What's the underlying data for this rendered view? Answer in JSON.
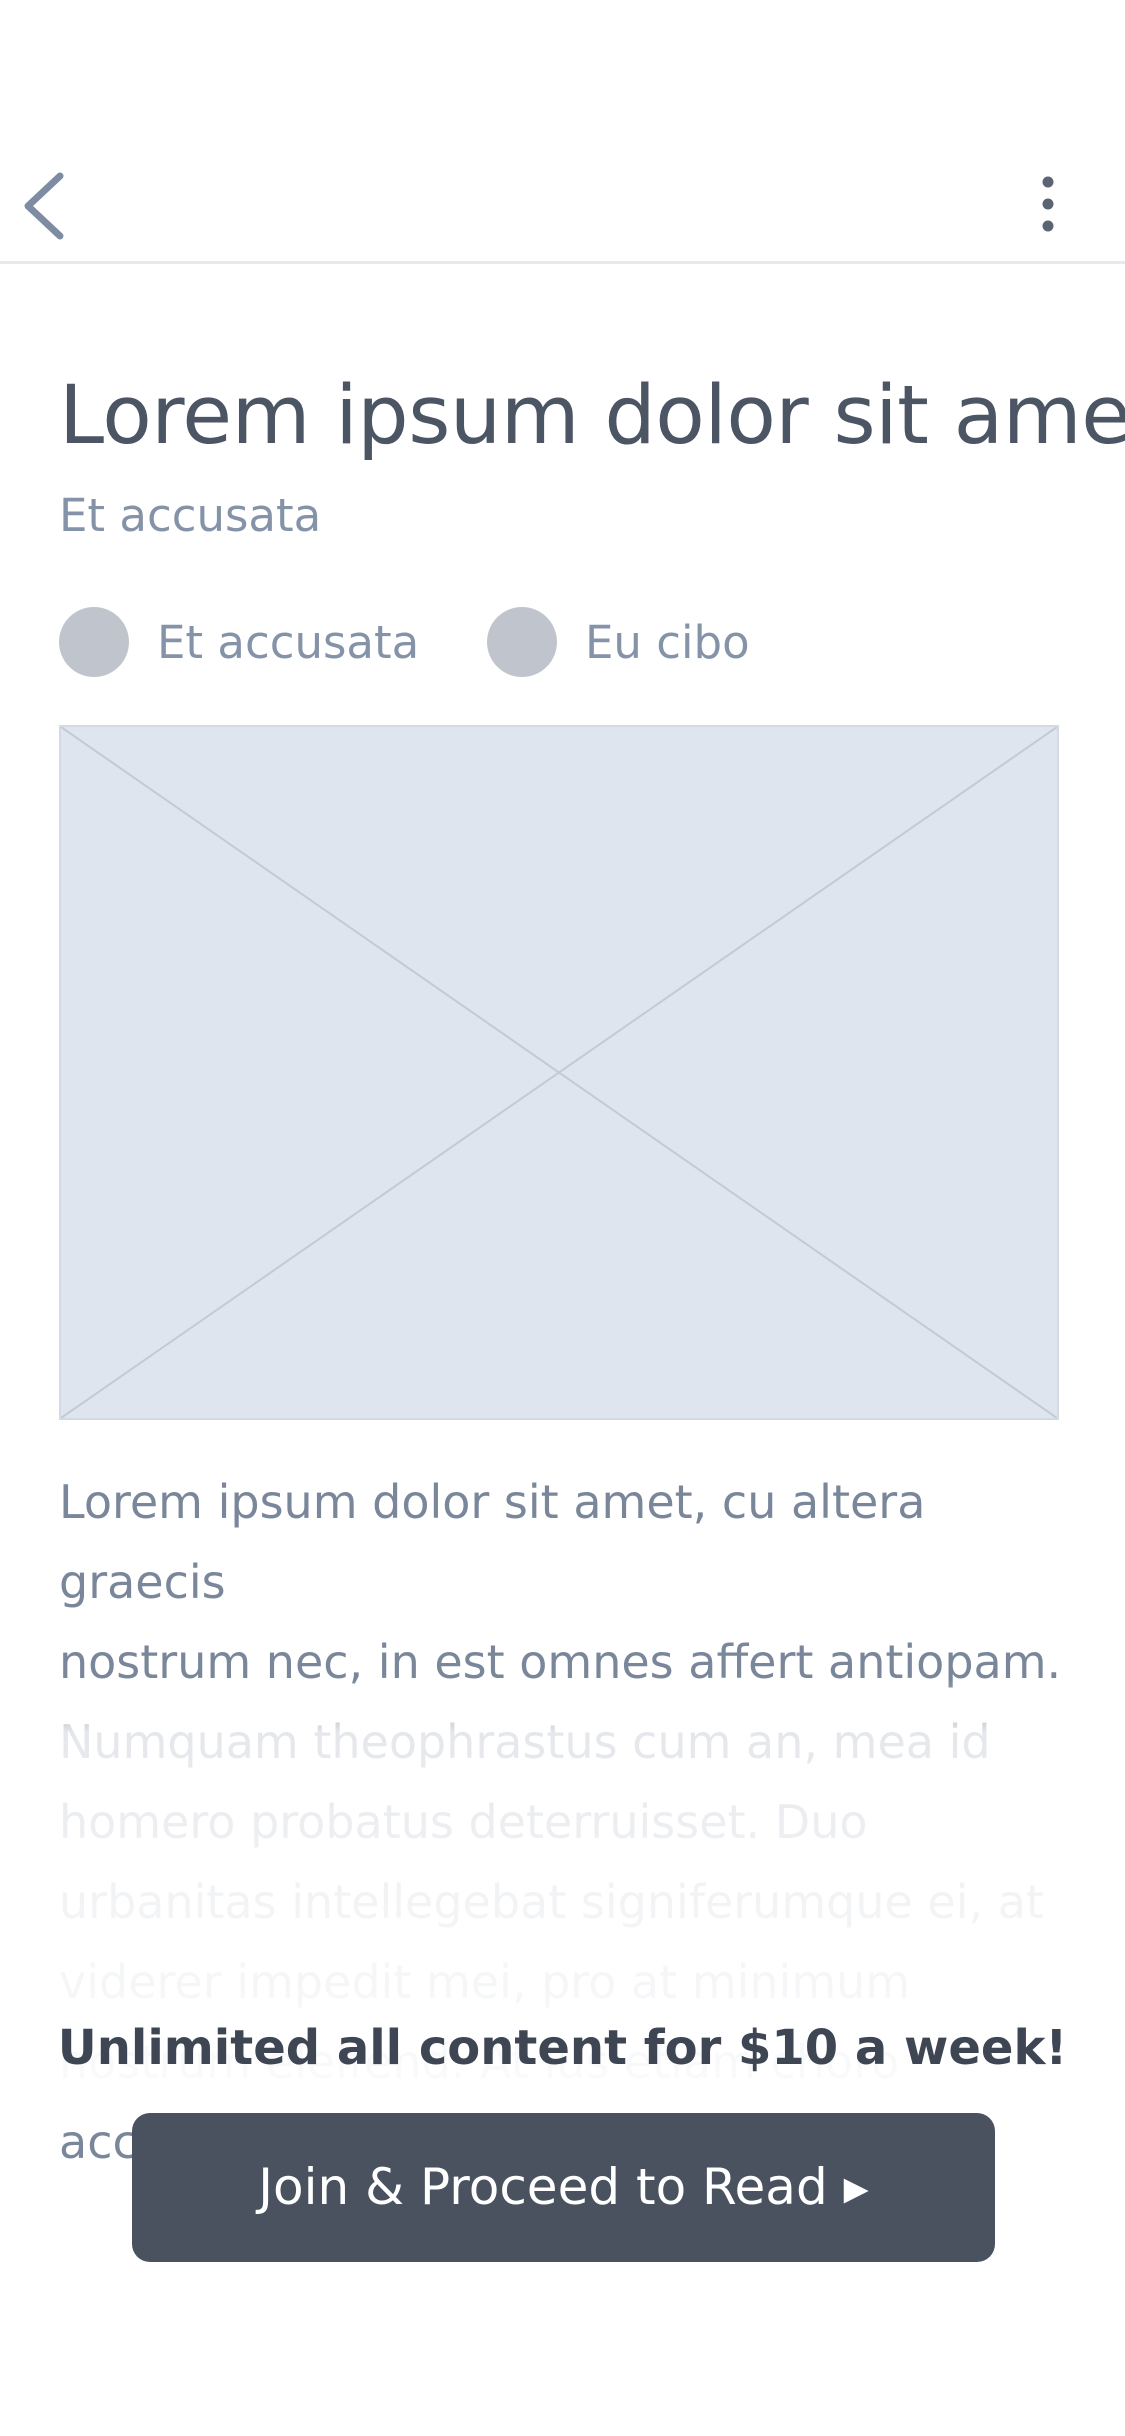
{
  "header": {
    "back_icon": "chevron-left-icon",
    "more_icon": "more-vertical-icon"
  },
  "article": {
    "title": "Lorem ipsum dolor sit amet",
    "subtitle": "Et accusata",
    "authors": [
      {
        "name": "Et accusata"
      },
      {
        "name": "Eu cibo"
      }
    ],
    "image_placeholder": "image-placeholder",
    "body": "Lorem ipsum dolor sit amet, cu altera graecis\nnostrum nec, in est omnes affert antiopam.\nNumquam theophrastus cum an, mea id\nhomero probatus deterruisset. Duo\nurbanitas intellegebat signiferumque ei, at\nviderer impedit mei, pro at minimum\nnostrum eleifend. At ius etiam choro\naccumsan, aliquip patrioque duo ne"
  },
  "paywall": {
    "message": "Unlimited all content for $10 a week!",
    "cta_label": "Join & Proceed to Read ▸"
  },
  "colors": {
    "title": "#4b5563",
    "muted": "#8593a8",
    "placeholder_bg": "#dfe5ee",
    "button_bg": "#4a525f",
    "button_text": "#ffffff"
  }
}
